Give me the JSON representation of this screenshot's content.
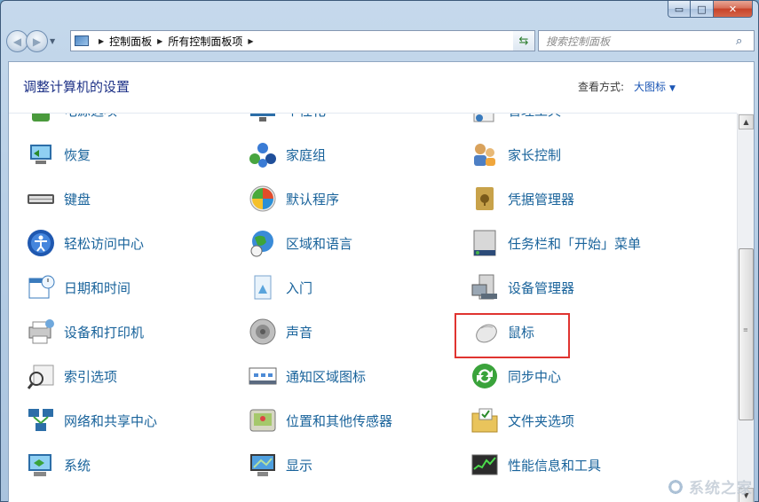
{
  "window": {
    "title_buttons": {
      "minimize": "▭",
      "maximize": "□",
      "close": "✕"
    }
  },
  "nav": {
    "breadcrumbs": [
      "控制面板",
      "所有控制面板项"
    ],
    "search_placeholder": "搜索控制面板"
  },
  "header": {
    "title": "调整计算机的设置",
    "view_label": "查看方式:",
    "view_value": "大图标"
  },
  "items": [
    {
      "label": "电源选项",
      "icon": "power-options-icon"
    },
    {
      "label": "个性化",
      "icon": "personalization-icon"
    },
    {
      "label": "管理工具",
      "icon": "admin-tools-icon"
    },
    {
      "label": "恢复",
      "icon": "recovery-icon"
    },
    {
      "label": "家庭组",
      "icon": "homegroup-icon"
    },
    {
      "label": "家长控制",
      "icon": "parental-controls-icon"
    },
    {
      "label": "键盘",
      "icon": "keyboard-icon"
    },
    {
      "label": "默认程序",
      "icon": "default-programs-icon"
    },
    {
      "label": "凭据管理器",
      "icon": "credential-manager-icon"
    },
    {
      "label": "轻松访问中心",
      "icon": "ease-of-access-icon"
    },
    {
      "label": "区域和语言",
      "icon": "region-language-icon"
    },
    {
      "label": "任务栏和「开始」菜单",
      "icon": "taskbar-icon"
    },
    {
      "label": "日期和时间",
      "icon": "date-time-icon"
    },
    {
      "label": "入门",
      "icon": "getting-started-icon"
    },
    {
      "label": "设备管理器",
      "icon": "device-manager-icon"
    },
    {
      "label": "设备和打印机",
      "icon": "devices-printers-icon"
    },
    {
      "label": "声音",
      "icon": "sound-icon"
    },
    {
      "label": "鼠标",
      "icon": "mouse-icon"
    },
    {
      "label": "索引选项",
      "icon": "indexing-icon"
    },
    {
      "label": "通知区域图标",
      "icon": "notification-area-icon"
    },
    {
      "label": "同步中心",
      "icon": "sync-center-icon"
    },
    {
      "label": "网络和共享中心",
      "icon": "network-sharing-icon"
    },
    {
      "label": "位置和其他传感器",
      "icon": "location-sensors-icon"
    },
    {
      "label": "文件夹选项",
      "icon": "folder-options-icon"
    },
    {
      "label": "系统",
      "icon": "system-icon"
    },
    {
      "label": "显示",
      "icon": "display-icon"
    },
    {
      "label": "性能信息和工具",
      "icon": "performance-icon"
    }
  ],
  "highlighted_item": "鼠标",
  "watermark": "系统之家"
}
